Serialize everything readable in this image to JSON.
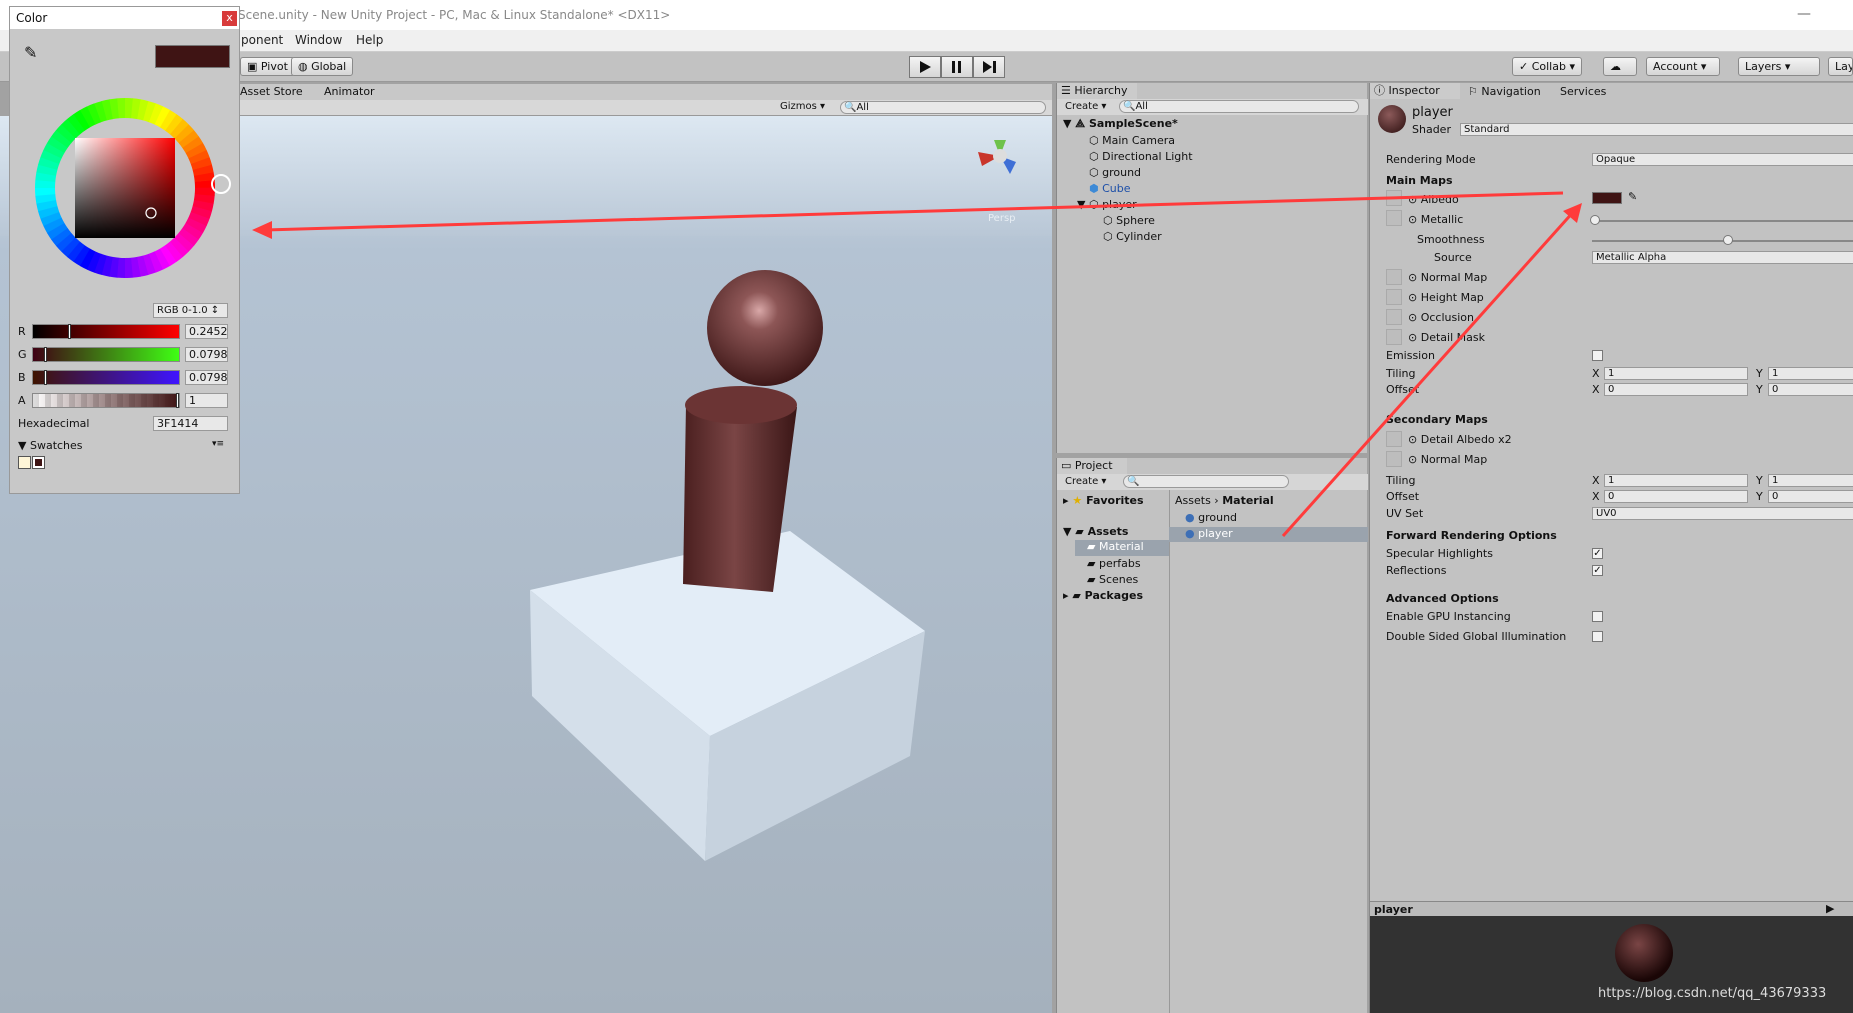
{
  "window": {
    "title": "Scene.unity - New Unity Project - PC, Mac & Linux Standalone* <DX11>",
    "min": "—"
  },
  "menu": [
    "ponent",
    "Window",
    "Help"
  ],
  "toolbar": {
    "pivot": "Pivot",
    "global": "Global",
    "collab": "Collab",
    "account": "Account",
    "layers": "Layers",
    "lay": "Lay"
  },
  "scene": {
    "tabs": [
      "Asset Store",
      "Animator"
    ],
    "gizmos": "Gizmos",
    "search_placeholder": "All",
    "persp": "Persp"
  },
  "hierarchy": {
    "tab": "Hierarchy",
    "create": "Create",
    "search_placeholder": "All",
    "scene": "SampleScene*",
    "items": [
      "Main Camera",
      "Directional Light",
      "ground",
      "Cube",
      "player",
      "Sphere",
      "Cylinder"
    ]
  },
  "project": {
    "tab": "Project",
    "create": "Create",
    "favorites": "Favorites",
    "assets": "Assets",
    "packages": "Packages",
    "folders": [
      "Material",
      "perfabs",
      "Scenes"
    ],
    "breadcrumb": [
      "Assets",
      "Material"
    ],
    "files": [
      "ground",
      "player"
    ]
  },
  "inspector": {
    "tabs": [
      "Inspector",
      "Navigation",
      "Services"
    ],
    "name": "player",
    "shader_label": "Shader",
    "shader": "Standard",
    "rendering_mode_label": "Rendering Mode",
    "rendering_mode": "Opaque",
    "main_maps": "Main Maps",
    "albedo": "Albedo",
    "metallic": "Metallic",
    "smoothness": "Smoothness",
    "source": "Source",
    "source_val": "Metallic Alpha",
    "normal_map": "Normal Map",
    "height_map": "Height Map",
    "occlusion": "Occlusion",
    "detail_mask": "Detail Mask",
    "emission": "Emission",
    "tiling": "Tiling",
    "offset": "Offset",
    "x": "X",
    "y": "Y",
    "one": "1",
    "zero": "0",
    "secondary_maps": "Secondary Maps",
    "detail_albedo": "Detail Albedo x2",
    "normal_map2": "Normal Map",
    "uv_set": "UV Set",
    "uv_val": "UV0",
    "forward": "Forward Rendering Options",
    "specular": "Specular Highlights",
    "reflections": "Reflections",
    "advanced": "Advanced Options",
    "gpu": "Enable GPU Instancing",
    "double_sided": "Double Sided Global Illumination",
    "preview_label": "player",
    "watermark": "https://blog.csdn.net/qq_43679333"
  },
  "color": {
    "title": "Color",
    "close": "x",
    "mode": "RGB 0-1.0",
    "r_label": "R",
    "g_label": "G",
    "b_label": "B",
    "a_label": "A",
    "r": "0.2452",
    "g": "0.0798",
    "b": "0.0798",
    "a": "1",
    "r_frac": 0.2452,
    "g_frac": 0.0798,
    "b_frac": 0.0798,
    "a_frac": 1,
    "hex_label": "Hexadecimal",
    "hex": "3F1414",
    "swatches": "Swatches",
    "swatch": "#3f1414"
  },
  "colors": {
    "accent_red": "#ff3b3b",
    "selection": "#3d6fb6",
    "material": "#3f1414"
  }
}
